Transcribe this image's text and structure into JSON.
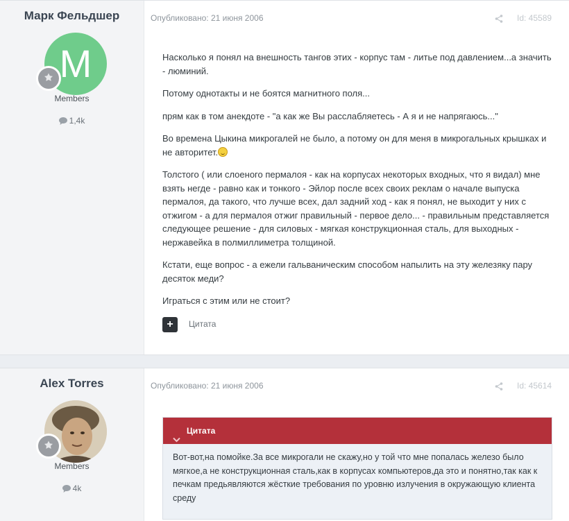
{
  "posts": [
    {
      "author": "Марк Фельдшер",
      "avatar_letter": "M",
      "group": "Members",
      "post_count": "1,4k",
      "published": "Опубликовано: 21 июня 2006",
      "id": "Id: 45589",
      "paragraphs": [
        "Насколько я понял на внешность тангов этих - корпус там - литье под давлением...а значить - люминий.",
        "Потому однотакты и не боятся магнитного поля...",
        "прям как в том анекдоте - \"а как же Вы расслабляетесь - А я и не напрягаюсь...\"",
        "Во времена Цыкина микрогалей не было, а потому он для меня в микрогальных крышках и не авторитет.",
        "Толстого ( или слоеного пермалоя - как на корпусах некоторых входных, что я видал) мне взять негде - равно как и тонкого - Эйлор после всех своих реклам о начале выпуска пермалоя, да такого, что лучше всех, дал задний ход - как я понял, не выходит у них с отжигом - а для пермалоя отжиг правильный - первое дело... - правильным представляется следующее решение - для силовых - мягкая конструкционная сталь, для выходных - нержавейка в полмиллиметра толщиной.",
        "Кстати, еще вопрос - а ежели гальваническим способом напылить на эту железяку пару десяток меди?",
        "Играться с этим или не стоит?"
      ],
      "quote_action": "Цитата",
      "emoji_icon": "grinning-face-icon"
    },
    {
      "author": "Alex Torres",
      "group": "Members",
      "post_count": "4k",
      "published": "Опубликовано: 21 июня 2006",
      "id": "Id: 45614",
      "quote_title": "Цитата",
      "quote_text": "Вот-вот,на помойке.За все микрогали не скажу,но у той что мне попалась железо было мягкое,а не конструкционная сталь,как в корпусах компьютеров,да это и понятно,так как к печкам предьявляются жёсткие требования по уровню излучения в окружающую клиента среду"
    }
  ],
  "colors": {
    "quote_header": "#b4303a",
    "avatar_green": "#6fcc8b",
    "page_bg": "#ebeef2"
  }
}
